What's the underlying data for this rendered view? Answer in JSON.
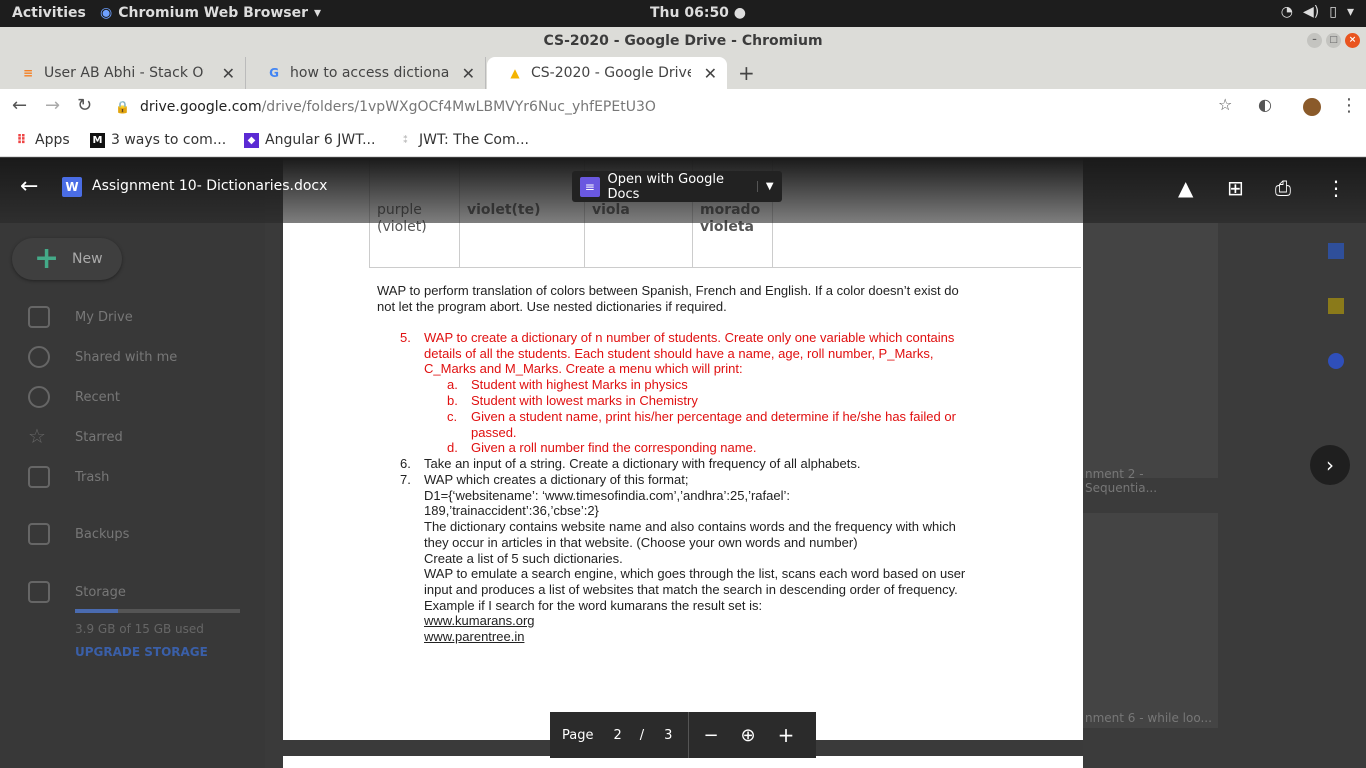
{
  "system_bar": {
    "activities": "Activities",
    "app_name": "Chromium Web Browser",
    "clock": "Thu 06:50"
  },
  "window": {
    "title": "CS-2020 - Google Drive - Chromium"
  },
  "tabs": [
    {
      "label": "User AB Abhi - Stack Over"
    },
    {
      "label": "how to access dictionary"
    },
    {
      "label": "CS-2020 - Google Drive"
    }
  ],
  "omnibox": {
    "domain": "drive.google.com",
    "path": "/drive/folders/1vpWXgOCf4MwLBMVYr6Nuc_yhfEPEtU3O"
  },
  "bookmarks": [
    {
      "label": "Apps"
    },
    {
      "label": "3 ways to com..."
    },
    {
      "label": "Angular 6 JWT..."
    },
    {
      "label": "JWT: The Com..."
    }
  ],
  "sidebar": {
    "new_label": "New",
    "items": [
      "My Drive",
      "Shared with me",
      "Recent",
      "Starred",
      "Trash",
      "Backups",
      "Storage"
    ],
    "storage_used": "3.9 GB of 15 GB used",
    "storage_fraction": 0.26,
    "upgrade": "UPGRADE STORAGE"
  },
  "viewer": {
    "doc_name": "Assignment 10- Dictionaries.docx",
    "open_with": "Open with Google Docs",
    "page_label": "Page",
    "page_current": "2",
    "page_sep": "/",
    "page_total": "3"
  },
  "table_row": [
    "purple (violet)",
    "violet(te)",
    "viola",
    "morado violeta"
  ],
  "doc": {
    "intro": "WAP to perform translation of colors between Spanish, French and English. If a color doesn’t exist do not let the program abort. Use nested dictionaries if required.",
    "q5_num": "5.",
    "q5": "WAP to create a dictionary of n number of students. Create only one variable which contains details of all the students. Each student should have a name, age, roll number, P_Marks, C_Marks and M_Marks. Create a menu which will print:",
    "q5_items": [
      {
        "n": "a.",
        "t": "Student with highest Marks in physics"
      },
      {
        "n": "b.",
        "t": "Student with lowest marks in Chemistry"
      },
      {
        "n": "c.",
        "t": "Given a student name, print his/her percentage and determine if he/she has failed or passed."
      },
      {
        "n": "d.",
        "t": "Given a roll number find the corresponding name."
      }
    ],
    "q6_num": "6.",
    "q6": "Take an input of a string. Create a dictionary with frequency of all alphabets.",
    "q7_num": "7.",
    "q7_lines": [
      "WAP which creates a dictionary of this format;",
      "D1={‘websitename’: ‘www.timesofindia.com’,’andhra’:25,’rafael’:",
      "189,’trainaccident’:36,’cbse’:2}",
      "The dictionary contains website name and also contains words and the frequency with which",
      "they occur in articles in that website. (Choose your own words and number)",
      "Create a list of 5 such dictionaries.",
      "WAP to emulate a search engine, which goes through the list, scans each word based on user",
      "input and produces a list of websites  that match the search in descending order of frequency.",
      "Example if I search for the word kumarans the result set is:"
    ],
    "links": [
      "www.kumarans.org",
      "www.parentree.in"
    ]
  },
  "right_panel": {
    "thumb1": "nment 2 - Sequentia...",
    "thumb2": "nment 6 - while loo..."
  },
  "colors": {
    "red": "#e01010",
    "accent_blue": "#4a6de5"
  }
}
